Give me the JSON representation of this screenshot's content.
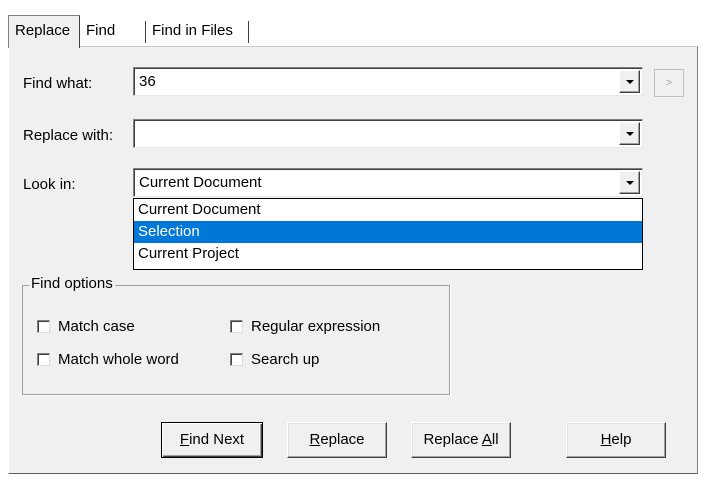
{
  "tabs": [
    {
      "label": "Replace",
      "active": true
    },
    {
      "label": "Find",
      "active": false
    },
    {
      "label": "Find in Files",
      "active": false
    }
  ],
  "find_what": {
    "label": "Find what:",
    "value": "36"
  },
  "expand_button": {
    "label": ">"
  },
  "replace_with": {
    "label": "Replace with:",
    "value": ""
  },
  "look_in": {
    "label": "Look in:",
    "value": "Current Document",
    "options": [
      "Current Document",
      "Selection",
      "Current Project"
    ],
    "highlighted": "Selection"
  },
  "find_options": {
    "title": "Find options",
    "match_case": {
      "label": "Match case",
      "checked": false
    },
    "regular_expression": {
      "label": "Regular expression",
      "checked": false
    },
    "match_whole_word": {
      "label": "Match whole word",
      "checked": false
    },
    "search_up": {
      "label": "Search up",
      "checked": false
    }
  },
  "buttons": {
    "find_next": {
      "accel": "F",
      "rest": "ind Next"
    },
    "replace": {
      "accel": "R",
      "rest": "eplace"
    },
    "replace_all": {
      "pre": "Replace ",
      "accel": "A",
      "rest": "ll"
    },
    "help": {
      "accel": "H",
      "rest": "elp"
    }
  },
  "colors": {
    "dialog_bg": "#f0f0f0",
    "selection_bg": "#0078d7",
    "selection_fg": "#ffffff"
  }
}
